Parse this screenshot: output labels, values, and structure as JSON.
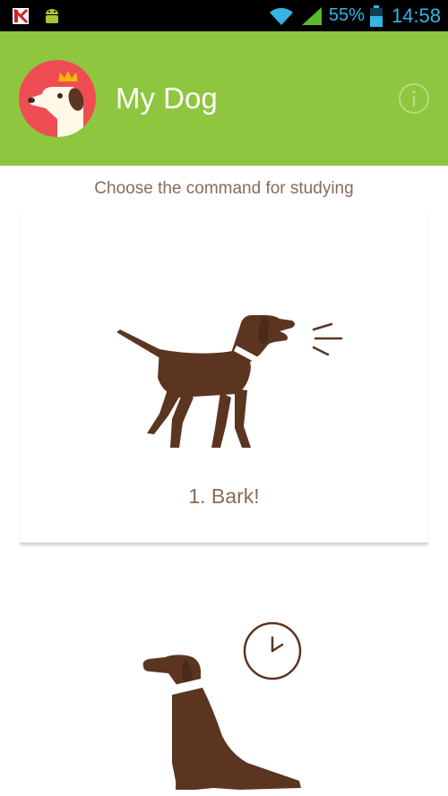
{
  "status_bar": {
    "battery": "55%",
    "time": "14:58",
    "icons": [
      "kaspersky-icon",
      "android-debug-icon",
      "wifi-icon",
      "signal-icon",
      "battery-icon"
    ]
  },
  "app_bar": {
    "title": "My Dog",
    "background": "#8ec63f"
  },
  "subtitle": "Choose the command for studying",
  "commands": [
    {
      "label": "1. Bark!",
      "icon": "barking-dog-icon"
    },
    {
      "label": "",
      "icon": "sitting-dog-clock-icon"
    }
  ],
  "colors": {
    "dog": "#5b3520",
    "text_brown": "#8a6a58",
    "avatar_red": "#ef4d53",
    "crown": "#f5b800"
  }
}
